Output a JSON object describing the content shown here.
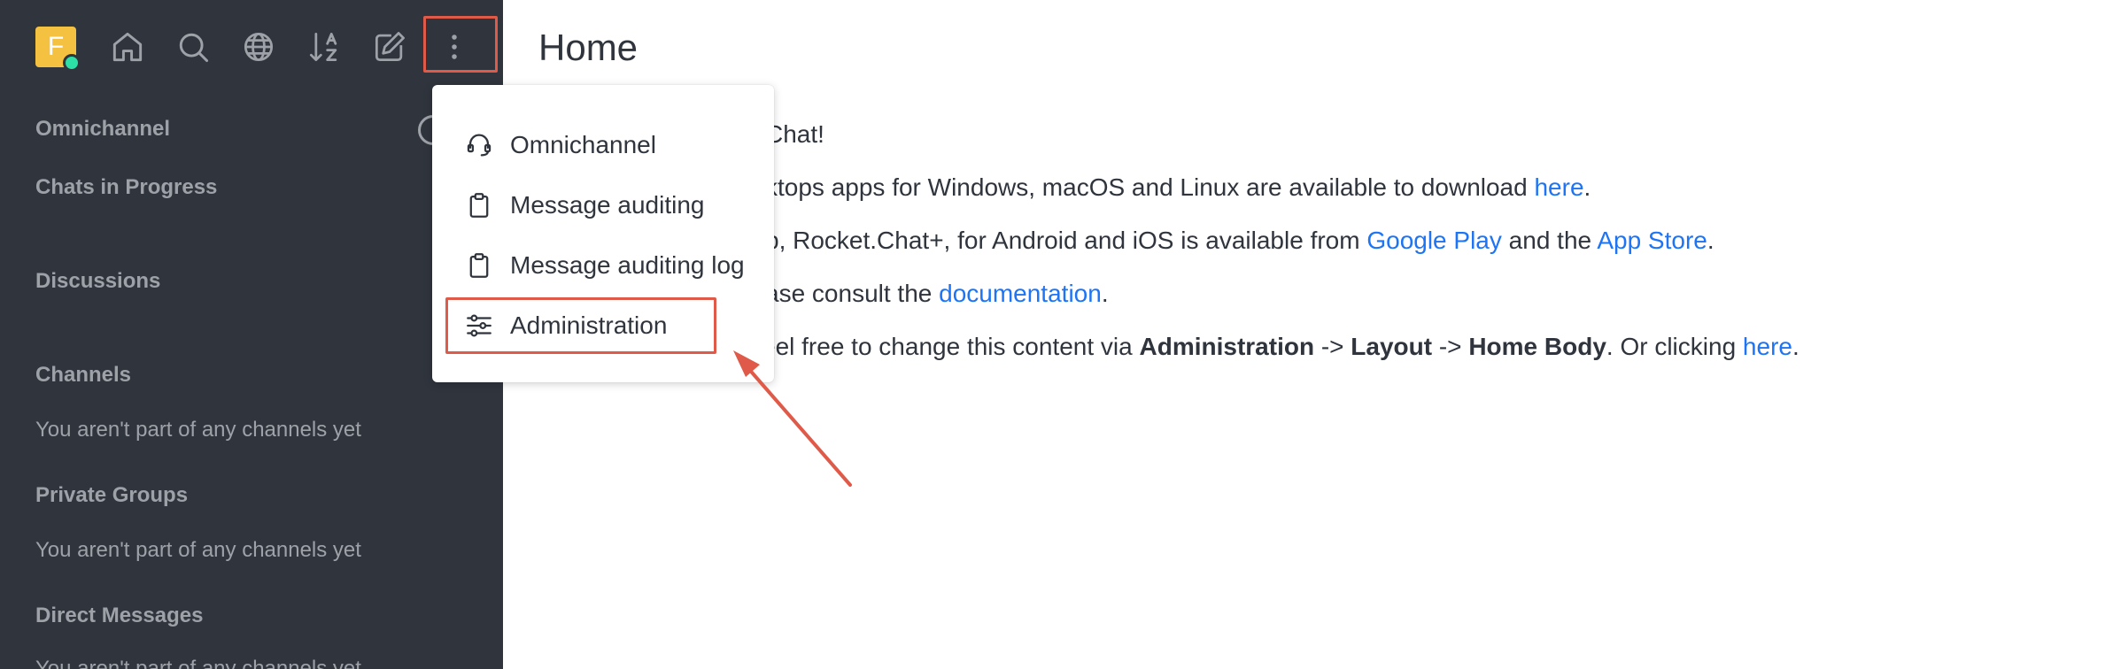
{
  "sidebar": {
    "avatar_letter": "F",
    "icons": [
      "home-icon",
      "search-icon",
      "globe-icon",
      "sort-icon",
      "edit-icon",
      "kebab-menu-icon"
    ],
    "sections": {
      "omnichannel": "Omnichannel",
      "chats_in_progress": "Chats in Progress",
      "discussions": "Discussions",
      "channels": "Channels",
      "private_groups": "Private Groups",
      "direct_messages": "Direct Messages"
    },
    "empty_text": "You aren't part of any channels yet"
  },
  "main": {
    "title": "Home",
    "lines": {
      "welcome": "Chat!",
      "desktop_pre": "ktops apps for Windows, macOS and Linux are available to download ",
      "desktop_link": "here",
      "desktop_post": ".",
      "mobile_pre": "p, Rocket.Chat+, for Android and iOS is available from ",
      "google_play": "Google Play",
      "mobile_mid": " and the ",
      "app_store": "App Store",
      "mobile_post": ".",
      "docs_pre": "ase consult the ",
      "docs_link": "documentation",
      "docs_post": ".",
      "admin_pre": "eel free to change this content via ",
      "admin_b1": "Administration",
      "admin_sep1": " -> ",
      "admin_b2": "Layout",
      "admin_sep2": " -> ",
      "admin_b3": "Home Body",
      "admin_post1": ". Or clicking ",
      "admin_link": "here",
      "admin_post2": "."
    }
  },
  "menu": {
    "items": [
      "Omnichannel",
      "Message auditing",
      "Message auditing log",
      "Administration"
    ]
  },
  "colors": {
    "sidebar_bg": "#2f343d",
    "highlight": "#e05a49",
    "link": "#1d74f5",
    "avatar": "#f5c141",
    "online": "#2de0a5"
  }
}
